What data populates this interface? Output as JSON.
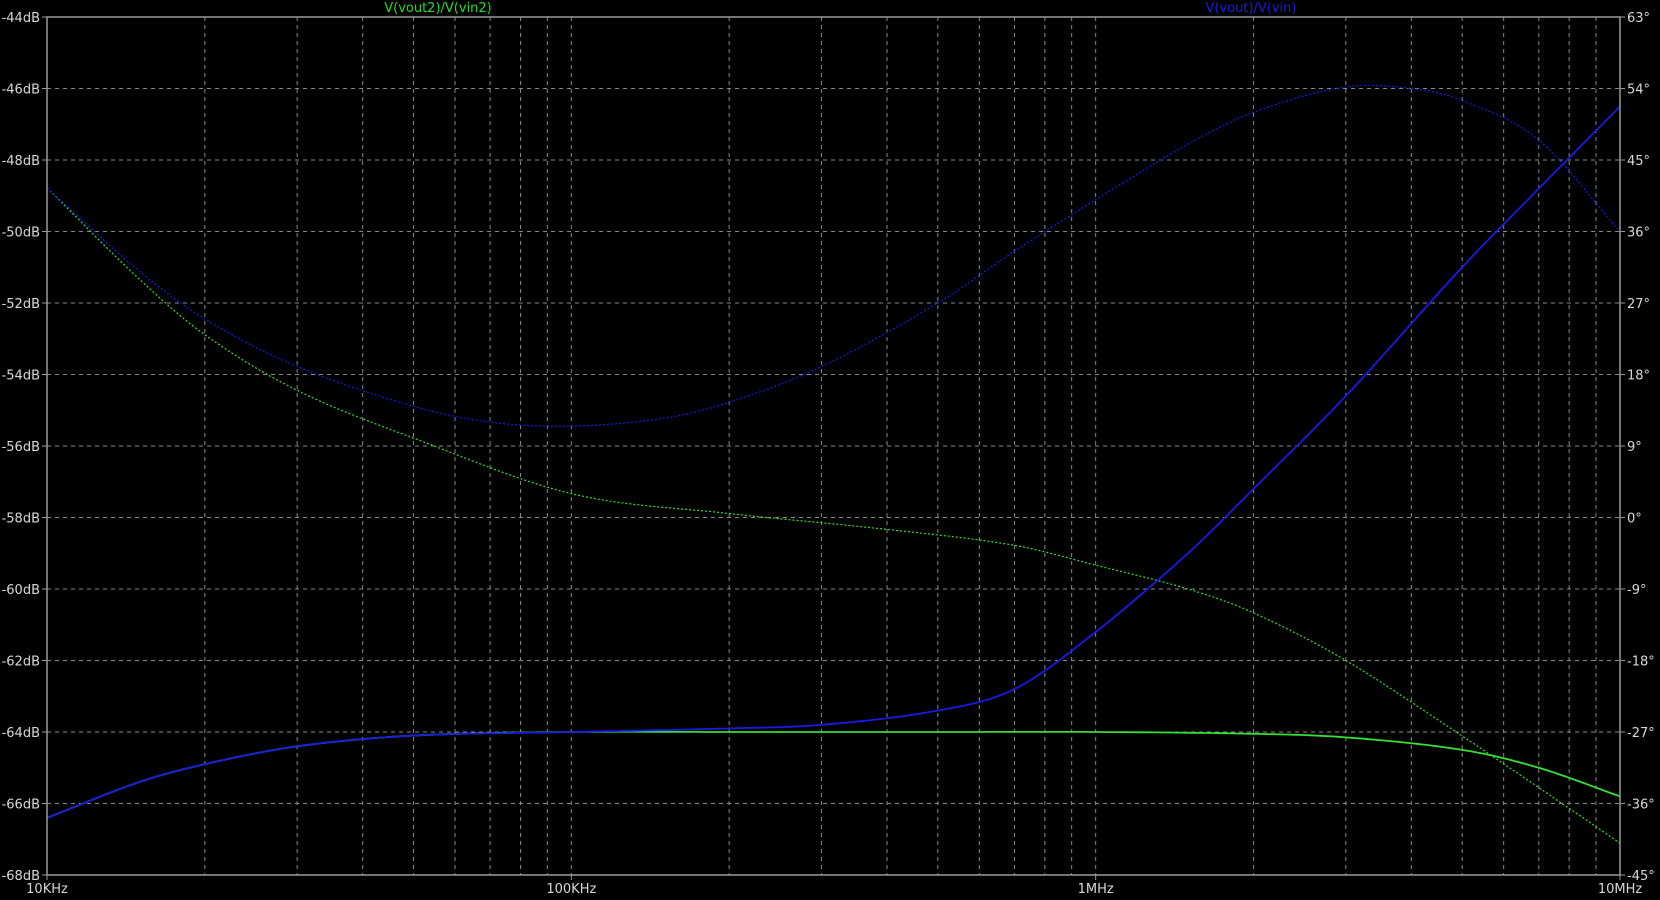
{
  "chart_data": {
    "type": "line",
    "x_scale": "log",
    "xlim_hz": [
      10000,
      10000000
    ],
    "ylim_db": [
      -68,
      -44
    ],
    "ylim_phase_deg": [
      -45,
      63
    ],
    "grid": true,
    "x_tick_labels": [
      "10KHz",
      "100KHz",
      "1MHz",
      "10MHz"
    ],
    "y_left_tick_labels": [
      "-44dB",
      "-46dB",
      "-48dB",
      "-50dB",
      "-52dB",
      "-54dB",
      "-56dB",
      "-58dB",
      "-60dB",
      "-62dB",
      "-64dB",
      "-66dB",
      "-68dB"
    ],
    "y_right_tick_labels": [
      "63°",
      "54°",
      "45°",
      "36°",
      "27°",
      "18°",
      "9°",
      "0°",
      "-9°",
      "-18°",
      "-27°",
      "-36°",
      "-45°"
    ],
    "legend": [
      {
        "label": "V(vout2)/V(vin2)",
        "color": "#22dd22"
      },
      {
        "label": "V(vout)/V(vin)",
        "color": "#1a1ae6"
      }
    ],
    "series": [
      {
        "name": "V(vout2)/V(vin2)",
        "quantity": "magnitude",
        "axis": "left",
        "style": "solid",
        "color": "#33e033",
        "x": [
          10000,
          15000,
          20000,
          30000,
          50000,
          100000,
          200000,
          500000,
          1000000,
          2000000,
          3000000,
          5000000,
          7000000,
          10000000
        ],
        "y": [
          -66.4,
          -65.4,
          -64.9,
          -64.4,
          -64.1,
          -64.0,
          -64.0,
          -64.0,
          -64.0,
          -64.05,
          -64.15,
          -64.5,
          -65.0,
          -65.8
        ]
      },
      {
        "name": "V(vout2)/V(vin2)",
        "quantity": "phase",
        "axis": "right",
        "style": "dashed",
        "color": "#33e033",
        "x": [
          10000,
          15000,
          20000,
          30000,
          50000,
          100000,
          200000,
          400000,
          700000,
          1000000,
          1500000,
          2000000,
          3000000,
          5000000,
          7000000,
          10000000
        ],
        "y": [
          41.5,
          30.0,
          23.0,
          16.0,
          10.0,
          3.0,
          0.5,
          -1.5,
          -3.5,
          -6.0,
          -9.0,
          -12.0,
          -18.0,
          -27.5,
          -34.0,
          -41.0
        ]
      },
      {
        "name": "V(vout)/V(vin)",
        "quantity": "magnitude",
        "axis": "left",
        "style": "solid",
        "color": "#1a1ae6",
        "x": [
          10000,
          15000,
          20000,
          30000,
          50000,
          100000,
          200000,
          300000,
          500000,
          700000,
          1000000,
          1500000,
          2000000,
          3000000,
          5000000,
          7000000,
          10000000
        ],
        "y": [
          -66.4,
          -65.4,
          -64.9,
          -64.4,
          -64.1,
          -64.0,
          -63.9,
          -63.8,
          -63.4,
          -62.8,
          -61.2,
          -59.0,
          -57.2,
          -54.6,
          -51.0,
          -48.8,
          -46.5
        ]
      },
      {
        "name": "V(vout)/V(vin)",
        "quantity": "phase",
        "axis": "right",
        "style": "dashed",
        "color": "#1a1ae6",
        "x": [
          10000,
          15000,
          20000,
          30000,
          50000,
          70000,
          100000,
          150000,
          200000,
          300000,
          500000,
          700000,
          1000000,
          1500000,
          2000000,
          3000000,
          4000000,
          5000000,
          7000000,
          10000000
        ],
        "y": [
          41.5,
          31.0,
          25.0,
          19.0,
          14.0,
          12.0,
          11.5,
          12.5,
          14.5,
          19.0,
          27.0,
          33.5,
          40.0,
          47.0,
          51.0,
          54.2,
          54.0,
          52.5,
          47.5,
          36.0
        ]
      }
    ]
  }
}
